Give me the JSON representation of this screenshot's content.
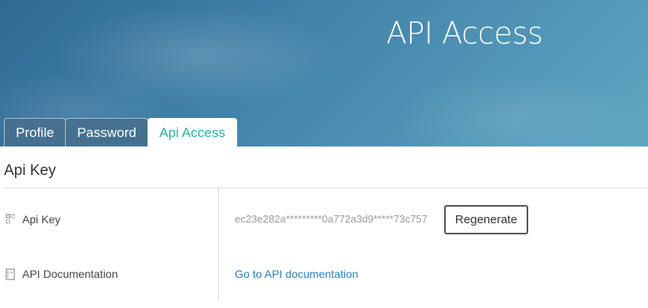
{
  "header": {
    "title": "API Access"
  },
  "tabs": [
    {
      "label": "Profile",
      "active": false
    },
    {
      "label": "Password",
      "active": false
    },
    {
      "label": "Api Access",
      "active": true
    }
  ],
  "section": {
    "title": "Api Key"
  },
  "rows": {
    "api_key": {
      "label": "Api Key",
      "icon": "key-icon",
      "value": "ec23e282a*********0a772a3d9*****73c757",
      "button_label": "Regenerate"
    },
    "api_docs": {
      "label": "API Documentation",
      "icon": "document-icon",
      "link_text": "Go to API documentation"
    }
  },
  "colors": {
    "active_tab_text": "#25b59a",
    "link": "#2a7fc4",
    "header_blue": "#3f7ea6"
  }
}
